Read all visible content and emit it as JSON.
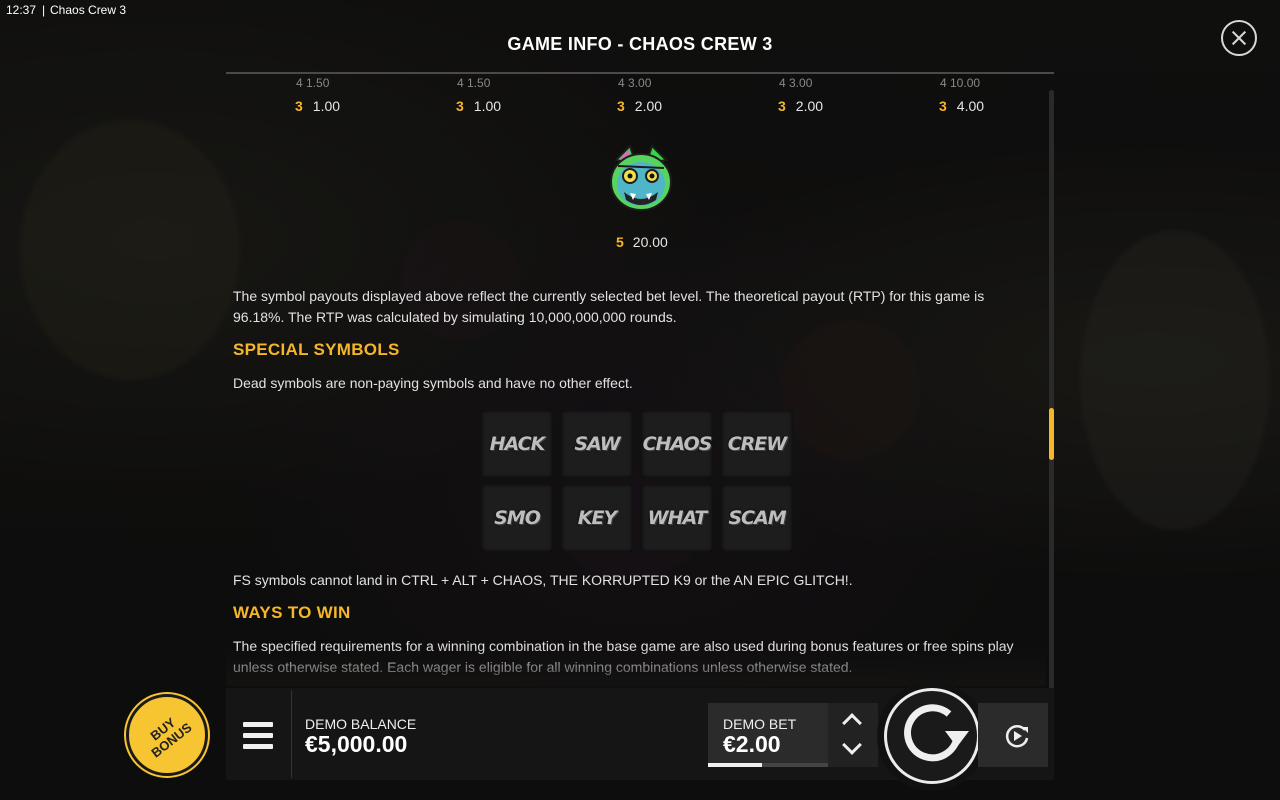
{
  "status_bar": {
    "time": "12:37",
    "separator": "|",
    "app_title": "Chaos Crew 3"
  },
  "panel": {
    "title": "GAME INFO - CHAOS CREW 3"
  },
  "paytable_row": [
    {
      "count": "3",
      "value": "1.00"
    },
    {
      "count": "3",
      "value": "1.00"
    },
    {
      "count": "3",
      "value": "2.00"
    },
    {
      "count": "3",
      "value": "2.00"
    },
    {
      "count": "3",
      "value": "4.00"
    }
  ],
  "paytable_cut_row": [
    "4 1.50",
    "4 1.50",
    "4 3.00",
    "4 3.00",
    "4 10.00"
  ],
  "wild_payout": {
    "count": "5",
    "value": "20.00"
  },
  "rtp_text": "The symbol payouts displayed above reflect the currently selected bet level. The theoretical payout (RTP) for this game is 96.18%. The RTP was calculated by simulating 10,000,000,000 rounds.",
  "special_symbols": {
    "heading": "SPECIAL SYMBOLS",
    "description": "Dead symbols are non-paying symbols and have no other effect.",
    "dead_symbols": [
      "HACK",
      "SAW",
      "CHAOS",
      "CREW",
      "SMO",
      "KEY",
      "WHAT",
      "SCAM"
    ],
    "fs_note": "FS symbols cannot land in CTRL + ALT + CHAOS, THE KORRUPTED K9 or the AN EPIC GLITCH!."
  },
  "ways_to_win": {
    "heading": "WAYS TO WIN",
    "text": "The specified requirements for a winning combination in the base game are also used during bonus features or free spins play unless otherwise stated. Each wager is eligible for all winning combinations unless otherwise stated."
  },
  "bottom_bar": {
    "buy_bonus_line1": "BUY",
    "buy_bonus_line2": "BONUS",
    "balance_label": "DEMO BALANCE",
    "balance_value": "€5,000.00",
    "bet_label": "DEMO BET",
    "bet_value": "€2.00"
  },
  "colors": {
    "accent": "#f5b62a",
    "buy_bonus": "#f7c531",
    "panel_bg": "#141312"
  },
  "icons": [
    "close-icon",
    "menu-icon",
    "chevron-up-icon",
    "chevron-down-icon",
    "spin-icon",
    "autoplay-icon",
    "wild-cat-symbol"
  ]
}
